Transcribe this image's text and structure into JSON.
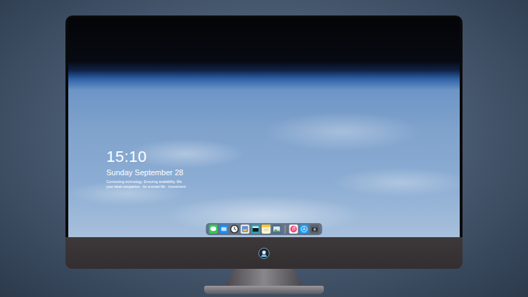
{
  "clock": {
    "time": "15:10",
    "date": "Sunday September 28",
    "caption": [
      "Connecting technology. Ensuring availability. We",
      "your ideal companion · for a smart life · Investment"
    ]
  }
}
